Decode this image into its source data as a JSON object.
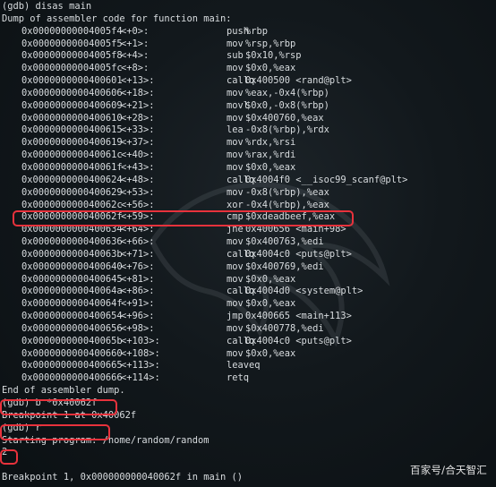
{
  "lines": [
    {
      "text": "(gdb) disas main"
    },
    {
      "text": "Dump of assembler code for function main:"
    }
  ],
  "asm": [
    {
      "addr": "0x00000000004005f4",
      "off": "<+0>:",
      "mn": "push",
      "op": "%rbp"
    },
    {
      "addr": "0x00000000004005f5",
      "off": "<+1>:",
      "mn": "mov",
      "op": "%rsp,%rbp"
    },
    {
      "addr": "0x00000000004005f8",
      "off": "<+4>:",
      "mn": "sub",
      "op": "$0x10,%rsp"
    },
    {
      "addr": "0x00000000004005fc",
      "off": "<+8>:",
      "mn": "mov",
      "op": "$0x0,%eax"
    },
    {
      "addr": "0x0000000000400601",
      "off": "<+13>:",
      "mn": "callq",
      "op": "0x400500 <rand@plt>"
    },
    {
      "addr": "0x0000000000400606",
      "off": "<+18>:",
      "mn": "mov",
      "op": "%eax,-0x4(%rbp)"
    },
    {
      "addr": "0x0000000000400609",
      "off": "<+21>:",
      "mn": "movl",
      "op": "$0x0,-0x8(%rbp)"
    },
    {
      "addr": "0x0000000000400610",
      "off": "<+28>:",
      "mn": "mov",
      "op": "$0x400760,%eax"
    },
    {
      "addr": "0x0000000000400615",
      "off": "<+33>:",
      "mn": "lea",
      "op": "-0x8(%rbp),%rdx"
    },
    {
      "addr": "0x0000000000400619",
      "off": "<+37>:",
      "mn": "mov",
      "op": "%rdx,%rsi"
    },
    {
      "addr": "0x000000000040061c",
      "off": "<+40>:",
      "mn": "mov",
      "op": "%rax,%rdi"
    },
    {
      "addr": "0x000000000040061f",
      "off": "<+43>:",
      "mn": "mov",
      "op": "$0x0,%eax"
    },
    {
      "addr": "0x0000000000400624",
      "off": "<+48>:",
      "mn": "callq",
      "op": "0x4004f0 <__isoc99_scanf@plt>"
    },
    {
      "addr": "0x0000000000400629",
      "off": "<+53>:",
      "mn": "mov",
      "op": "-0x8(%rbp),%eax"
    },
    {
      "addr": "0x000000000040062c",
      "off": "<+56>:",
      "mn": "xor",
      "op": "-0x4(%rbp),%eax"
    },
    {
      "addr": "0x000000000040062f",
      "off": "<+59>:",
      "mn": "cmp",
      "op": "$0xdeadbeef,%eax"
    },
    {
      "addr": "0x0000000000400634",
      "off": "<+64>:",
      "mn": "jne",
      "op": "0x400656 <main+98>"
    },
    {
      "addr": "0x0000000000400636",
      "off": "<+66>:",
      "mn": "mov",
      "op": "$0x400763,%edi"
    },
    {
      "addr": "0x000000000040063b",
      "off": "<+71>:",
      "mn": "callq",
      "op": "0x4004c0 <puts@plt>"
    },
    {
      "addr": "0x0000000000400640",
      "off": "<+76>:",
      "mn": "mov",
      "op": "$0x400769,%edi"
    },
    {
      "addr": "0x0000000000400645",
      "off": "<+81>:",
      "mn": "mov",
      "op": "$0x0,%eax"
    },
    {
      "addr": "0x000000000040064a",
      "off": "<+86>:",
      "mn": "callq",
      "op": "0x4004d0 <system@plt>"
    },
    {
      "addr": "0x000000000040064f",
      "off": "<+91>:",
      "mn": "mov",
      "op": "$0x0,%eax"
    },
    {
      "addr": "0x0000000000400654",
      "off": "<+96>:",
      "mn": "jmp",
      "op": "0x400665 <main+113>"
    },
    {
      "addr": "0x0000000000400656",
      "off": "<+98>:",
      "mn": "mov",
      "op": "$0x400778,%edi"
    },
    {
      "addr": "0x000000000040065b",
      "off": "<+103>:",
      "mn": "callq",
      "op": "0x4004c0 <puts@plt>"
    },
    {
      "addr": "0x0000000000400660",
      "off": "<+108>:",
      "mn": "mov",
      "op": "$0x0,%eax"
    },
    {
      "addr": "0x0000000000400665",
      "off": "<+113>:",
      "mn": "leaveq",
      "op": ""
    },
    {
      "addr": "0x0000000000400666",
      "off": "<+114>:",
      "mn": "retq",
      "op": ""
    }
  ],
  "tail": [
    {
      "text": "End of assembler dump."
    },
    {
      "text": "(gdb) b *0x40062f"
    },
    {
      "text": "Breakpoint 1 at 0x40062f"
    },
    {
      "text": "(gdb) r"
    },
    {
      "text": "Starting program: /home/random/random"
    },
    {
      "text": "2"
    },
    {
      "text": ""
    },
    {
      "text": "Breakpoint 1, 0x000000000040062f in main ()"
    }
  ],
  "watermark": "百家号/合天智汇",
  "colors": {
    "background": "#12181c",
    "text": "#d8dcdf",
    "highlight": "#e8323c"
  }
}
